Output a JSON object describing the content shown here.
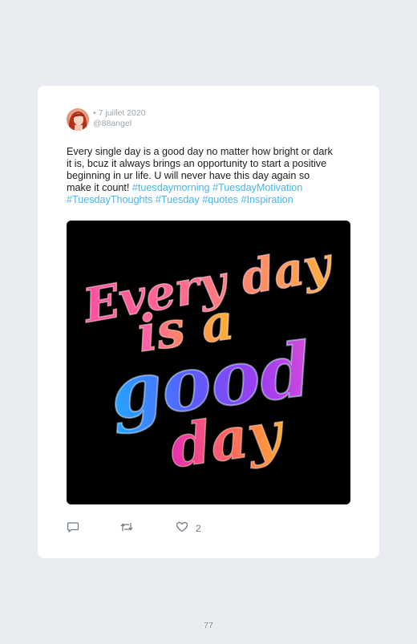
{
  "post": {
    "date": "• 7 juillet 2020",
    "handle": "@88angel",
    "text_lines": [
      {
        "plain": "Every single day is a good day no matter how bright or dark",
        "tags": []
      },
      {
        "plain": "it is, bcuz it always brings an opportunity to start a positive",
        "tags": []
      },
      {
        "plain": "beginning in ur life. U will never have this day again so",
        "tags": []
      },
      {
        "plain": "make it count! ",
        "tags": [
          "#tuesdaymorning",
          "#TuesdayMotivation"
        ]
      },
      {
        "plain": "",
        "tags": [
          "#TuesdayThoughts",
          "#Tuesday",
          "#quotes",
          "#Inspiration"
        ]
      }
    ],
    "image_text": {
      "line1": "Every day",
      "line2": "is a",
      "line3": "good",
      "line4": "day"
    },
    "likes": "2"
  },
  "page": {
    "number": "77"
  },
  "icons": {
    "reply": "reply-icon",
    "retweet": "retweet-icon",
    "like": "heart-icon"
  },
  "colors": {
    "background": "#e9ecf0",
    "card": "#ffffff",
    "hashtag": "#44b6f2",
    "meta": "#9aa4ad",
    "icon": "#6f7b86"
  }
}
